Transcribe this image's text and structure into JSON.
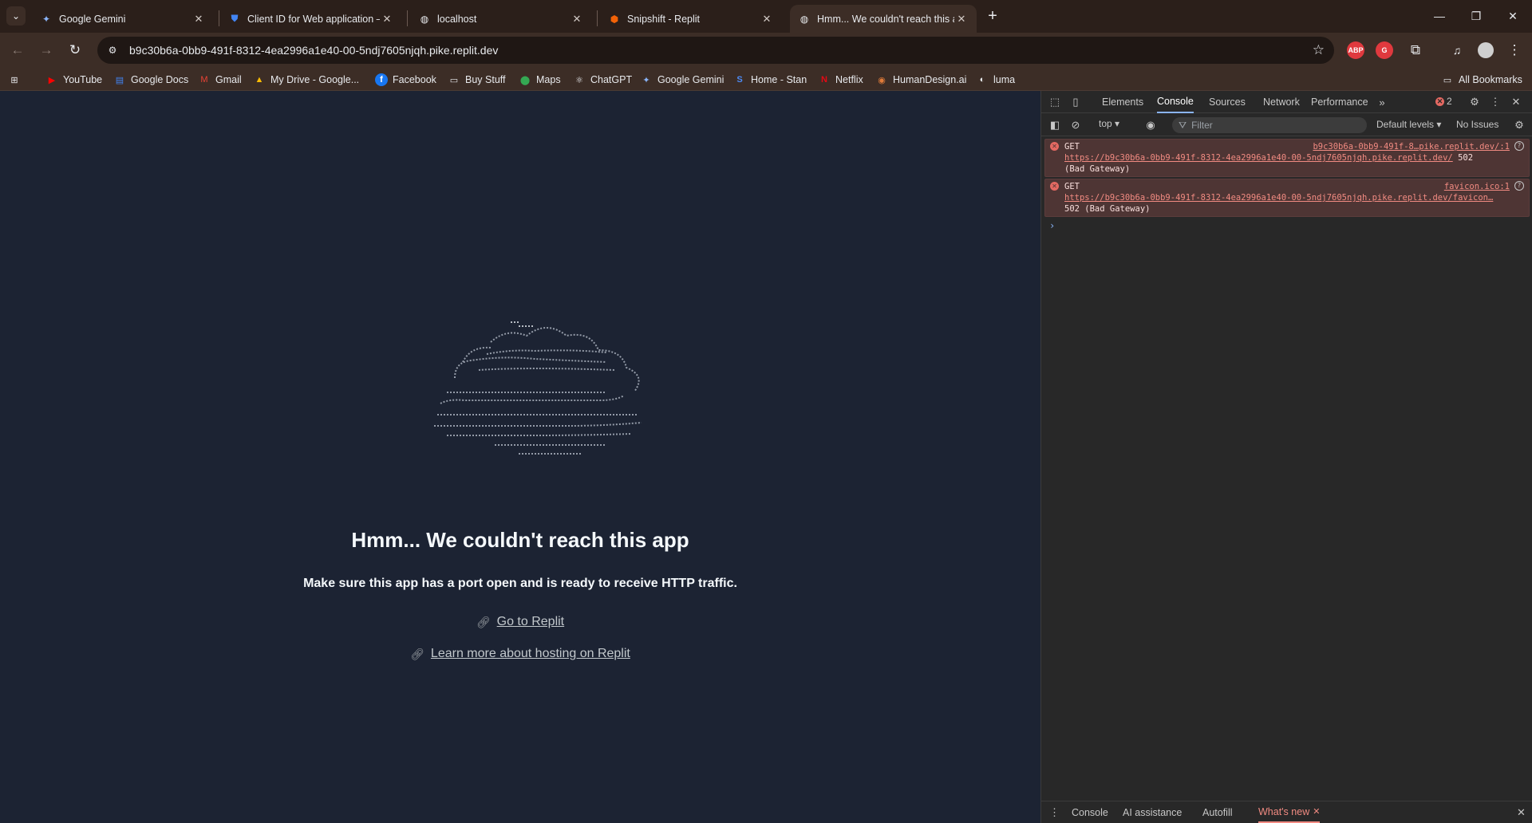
{
  "tabs": [
    {
      "title": "Google Gemini",
      "icon": "gemini-icon"
    },
    {
      "title": "Client ID for Web application –",
      "icon": "shield-icon"
    },
    {
      "title": "localhost",
      "icon": "globe-icon"
    },
    {
      "title": "Snipshift - Replit",
      "icon": "replit-icon"
    },
    {
      "title": "Hmm... We couldn't reach this a",
      "icon": "globe-icon",
      "active": true
    }
  ],
  "address_bar": {
    "url": "b9c30b6a-0bb9-491f-8312-4ea2996a1e40-00-5ndj7605njqh.pike.replit.dev"
  },
  "extensions": {
    "abp": "ABP",
    "grammarly": "G"
  },
  "bookmarks": [
    {
      "label": "YouTube",
      "icon": "youtube-icon"
    },
    {
      "label": "Google Docs",
      "icon": "docs-icon"
    },
    {
      "label": "Gmail",
      "icon": "gmail-icon"
    },
    {
      "label": "My Drive - Google...",
      "icon": "drive-icon"
    },
    {
      "label": "Facebook",
      "icon": "facebook-icon"
    },
    {
      "label": "Buy Stuff",
      "icon": "folder-icon"
    },
    {
      "label": "Maps",
      "icon": "maps-icon"
    },
    {
      "label": "ChatGPT",
      "icon": "chatgpt-icon"
    },
    {
      "label": "Google Gemini",
      "icon": "gemini-icon"
    },
    {
      "label": "Home - Stan",
      "icon": "stan-icon"
    },
    {
      "label": "Netflix",
      "icon": "netflix-icon"
    },
    {
      "label": "HumanDesign.ai",
      "icon": "humandesign-icon"
    },
    {
      "label": "luma",
      "icon": "luma-icon"
    }
  ],
  "all_bookmarks": "All Bookmarks",
  "page": {
    "heading": "Hmm... We couldn't reach this app",
    "subtext": "Make sure this app has a port open and is ready to receive HTTP traffic.",
    "link1": "Go to Replit",
    "link2": "Learn more about hosting on Replit"
  },
  "devtools": {
    "tabs": [
      "Elements",
      "Console",
      "Sources",
      "Network",
      "Performance"
    ],
    "active_tab": "Console",
    "error_count": "2",
    "context": "top",
    "filter_placeholder": "Filter",
    "levels": "Default levels",
    "issues": "No Issues",
    "messages": [
      {
        "method": "GET",
        "source": "b9c30b6a-0bb9-491f-8…pike.replit.dev/:1",
        "url": "https://b9c30b6a-0bb9-491f-8312-4ea2996a1e40-00-5ndj7605njqh.pike.replit.dev/",
        "status_inline": "502",
        "status_text": "(Bad Gateway)"
      },
      {
        "method": "GET",
        "source": "favicon.ico:1",
        "url": "https://b9c30b6a-0bb9-491f-8312-4ea2996a1e40-00-5ndj7605njqh.pike.replit.dev/favicon…",
        "status_text": "502 (Bad Gateway)"
      }
    ],
    "drawer_tabs": [
      "Console",
      "AI assistance",
      "Autofill",
      "What's new"
    ]
  }
}
